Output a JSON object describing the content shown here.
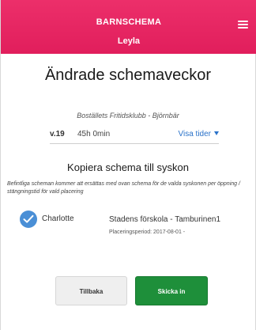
{
  "header": {
    "app_title": "BARNSCHEMA",
    "child_name": "Leyla",
    "menu_icon": "hamburger-menu-icon",
    "color": "#e11e5c"
  },
  "main": {
    "title": "Ändrade schemaveckor",
    "location": "Boställets Fritidsklubb - Björnbär",
    "week": {
      "number": "v.19",
      "hours": "45h 0min",
      "show_times_label": "Visa tider"
    },
    "copy": {
      "title": "Kopiera schema till syskon",
      "note": "Befintliga scheman kommer att ersättas med ovan schema för de valda syskonen per öppning / stängningstid för vald placering",
      "siblings": [
        {
          "name": "Charlotte",
          "checked": true,
          "preschool": "Stadens förskola - Tamburinen1",
          "placement": "Placeringsperiod: 2017-08-01 -"
        }
      ]
    }
  },
  "buttons": {
    "back_label": "Tillbaka",
    "submit_label": "Skicka in",
    "submit_color": "#1e8f3a"
  }
}
